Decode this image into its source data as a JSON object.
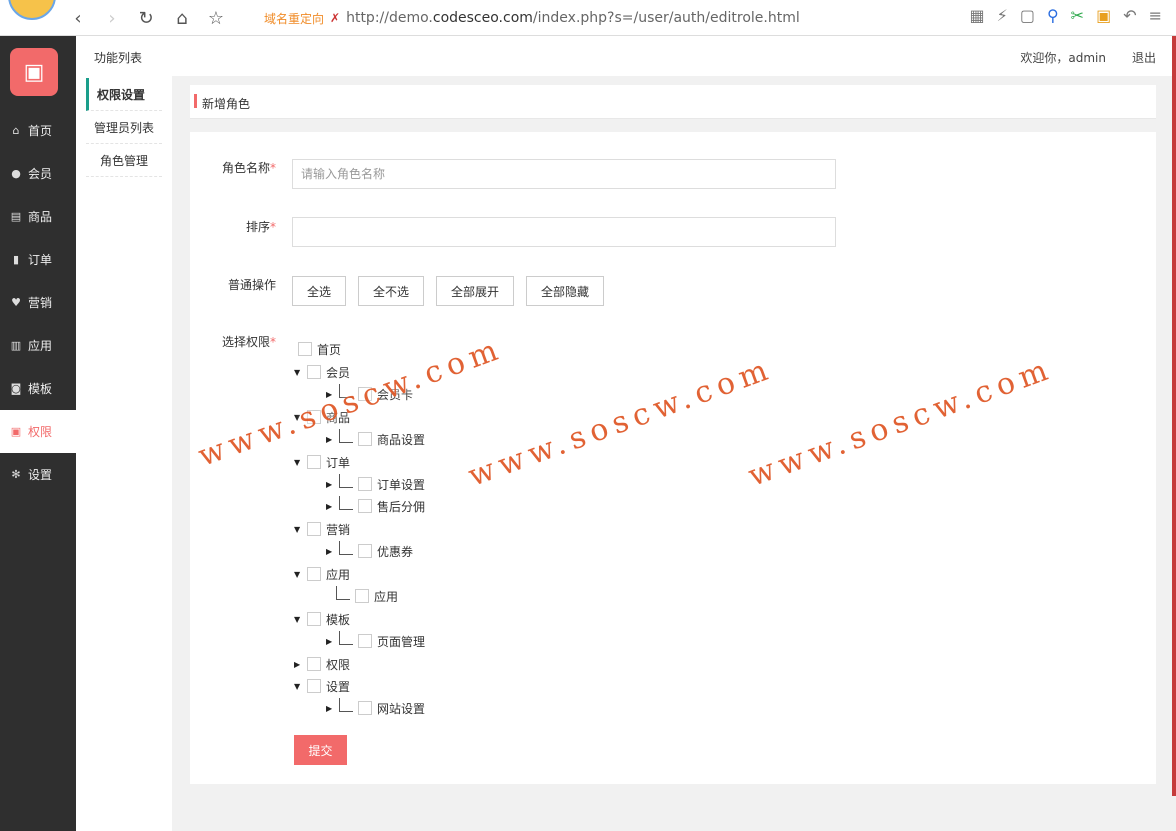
{
  "browser": {
    "redirect_label": "域名重定向",
    "url_prefix": "http://demo.",
    "url_domain": "codesceo.com",
    "url_path": "/index.php?s=/user/auth/editrole.html"
  },
  "sidebar": {
    "items": [
      {
        "label": "首页",
        "icon": "home-icon"
      },
      {
        "label": "会员",
        "icon": "user-icon"
      },
      {
        "label": "商品",
        "icon": "gift-icon"
      },
      {
        "label": "订单",
        "icon": "clipboard-icon"
      },
      {
        "label": "营销",
        "icon": "heart-icon"
      },
      {
        "label": "应用",
        "icon": "bank-icon"
      },
      {
        "label": "模板",
        "icon": "camera-icon"
      },
      {
        "label": "权限",
        "icon": "lock-icon"
      },
      {
        "label": "设置",
        "icon": "gear-icon"
      }
    ]
  },
  "subnav": {
    "title": "功能列表",
    "items": [
      "权限设置",
      "管理员列表",
      "角色管理"
    ]
  },
  "topbar": {
    "welcome": "欢迎你，admin",
    "logout": "退出"
  },
  "panel": {
    "title": "新增角色"
  },
  "form": {
    "role_name_label": "角色名称",
    "role_name_placeholder": "请输入角色名称",
    "sort_label": "排序",
    "sort_value": "",
    "ops_label": "普通操作",
    "ops": [
      "全选",
      "全不选",
      "全部展开",
      "全部隐藏"
    ],
    "perm_label": "选择权限",
    "required_mark": "*",
    "submit": "提交"
  },
  "tree": [
    {
      "label": "首页"
    },
    {
      "label": "会员"
    },
    {
      "label": "会员卡"
    },
    {
      "label": "商品"
    },
    {
      "label": "商品设置"
    },
    {
      "label": "订单"
    },
    {
      "label": "订单设置"
    },
    {
      "label": "售后分佣"
    },
    {
      "label": "营销"
    },
    {
      "label": "优惠券"
    },
    {
      "label": "应用"
    },
    {
      "label": "应用"
    },
    {
      "label": "模板"
    },
    {
      "label": "页面管理"
    },
    {
      "label": "权限"
    },
    {
      "label": "设置"
    },
    {
      "label": "网站设置"
    }
  ],
  "watermark": "www.soscw.com"
}
